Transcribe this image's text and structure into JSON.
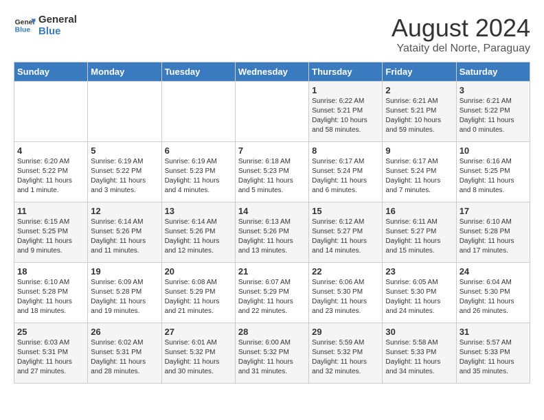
{
  "logo": {
    "general": "General",
    "blue": "Blue"
  },
  "title": {
    "month_year": "August 2024",
    "location": "Yataity del Norte, Paraguay"
  },
  "headers": [
    "Sunday",
    "Monday",
    "Tuesday",
    "Wednesday",
    "Thursday",
    "Friday",
    "Saturday"
  ],
  "weeks": [
    [
      {
        "day": "",
        "info": ""
      },
      {
        "day": "",
        "info": ""
      },
      {
        "day": "",
        "info": ""
      },
      {
        "day": "",
        "info": ""
      },
      {
        "day": "1",
        "info": "Sunrise: 6:22 AM\nSunset: 5:21 PM\nDaylight: 10 hours and 58 minutes."
      },
      {
        "day": "2",
        "info": "Sunrise: 6:21 AM\nSunset: 5:21 PM\nDaylight: 10 hours and 59 minutes."
      },
      {
        "day": "3",
        "info": "Sunrise: 6:21 AM\nSunset: 5:22 PM\nDaylight: 11 hours and 0 minutes."
      }
    ],
    [
      {
        "day": "4",
        "info": "Sunrise: 6:20 AM\nSunset: 5:22 PM\nDaylight: 11 hours and 1 minute."
      },
      {
        "day": "5",
        "info": "Sunrise: 6:19 AM\nSunset: 5:22 PM\nDaylight: 11 hours and 3 minutes."
      },
      {
        "day": "6",
        "info": "Sunrise: 6:19 AM\nSunset: 5:23 PM\nDaylight: 11 hours and 4 minutes."
      },
      {
        "day": "7",
        "info": "Sunrise: 6:18 AM\nSunset: 5:23 PM\nDaylight: 11 hours and 5 minutes."
      },
      {
        "day": "8",
        "info": "Sunrise: 6:17 AM\nSunset: 5:24 PM\nDaylight: 11 hours and 6 minutes."
      },
      {
        "day": "9",
        "info": "Sunrise: 6:17 AM\nSunset: 5:24 PM\nDaylight: 11 hours and 7 minutes."
      },
      {
        "day": "10",
        "info": "Sunrise: 6:16 AM\nSunset: 5:25 PM\nDaylight: 11 hours and 8 minutes."
      }
    ],
    [
      {
        "day": "11",
        "info": "Sunrise: 6:15 AM\nSunset: 5:25 PM\nDaylight: 11 hours and 9 minutes."
      },
      {
        "day": "12",
        "info": "Sunrise: 6:14 AM\nSunset: 5:26 PM\nDaylight: 11 hours and 11 minutes."
      },
      {
        "day": "13",
        "info": "Sunrise: 6:14 AM\nSunset: 5:26 PM\nDaylight: 11 hours and 12 minutes."
      },
      {
        "day": "14",
        "info": "Sunrise: 6:13 AM\nSunset: 5:26 PM\nDaylight: 11 hours and 13 minutes."
      },
      {
        "day": "15",
        "info": "Sunrise: 6:12 AM\nSunset: 5:27 PM\nDaylight: 11 hours and 14 minutes."
      },
      {
        "day": "16",
        "info": "Sunrise: 6:11 AM\nSunset: 5:27 PM\nDaylight: 11 hours and 15 minutes."
      },
      {
        "day": "17",
        "info": "Sunrise: 6:10 AM\nSunset: 5:28 PM\nDaylight: 11 hours and 17 minutes."
      }
    ],
    [
      {
        "day": "18",
        "info": "Sunrise: 6:10 AM\nSunset: 5:28 PM\nDaylight: 11 hours and 18 minutes."
      },
      {
        "day": "19",
        "info": "Sunrise: 6:09 AM\nSunset: 5:28 PM\nDaylight: 11 hours and 19 minutes."
      },
      {
        "day": "20",
        "info": "Sunrise: 6:08 AM\nSunset: 5:29 PM\nDaylight: 11 hours and 21 minutes."
      },
      {
        "day": "21",
        "info": "Sunrise: 6:07 AM\nSunset: 5:29 PM\nDaylight: 11 hours and 22 minutes."
      },
      {
        "day": "22",
        "info": "Sunrise: 6:06 AM\nSunset: 5:30 PM\nDaylight: 11 hours and 23 minutes."
      },
      {
        "day": "23",
        "info": "Sunrise: 6:05 AM\nSunset: 5:30 PM\nDaylight: 11 hours and 24 minutes."
      },
      {
        "day": "24",
        "info": "Sunrise: 6:04 AM\nSunset: 5:30 PM\nDaylight: 11 hours and 26 minutes."
      }
    ],
    [
      {
        "day": "25",
        "info": "Sunrise: 6:03 AM\nSunset: 5:31 PM\nDaylight: 11 hours and 27 minutes."
      },
      {
        "day": "26",
        "info": "Sunrise: 6:02 AM\nSunset: 5:31 PM\nDaylight: 11 hours and 28 minutes."
      },
      {
        "day": "27",
        "info": "Sunrise: 6:01 AM\nSunset: 5:32 PM\nDaylight: 11 hours and 30 minutes."
      },
      {
        "day": "28",
        "info": "Sunrise: 6:00 AM\nSunset: 5:32 PM\nDaylight: 11 hours and 31 minutes."
      },
      {
        "day": "29",
        "info": "Sunrise: 5:59 AM\nSunset: 5:32 PM\nDaylight: 11 hours and 32 minutes."
      },
      {
        "day": "30",
        "info": "Sunrise: 5:58 AM\nSunset: 5:33 PM\nDaylight: 11 hours and 34 minutes."
      },
      {
        "day": "31",
        "info": "Sunrise: 5:57 AM\nSunset: 5:33 PM\nDaylight: 11 hours and 35 minutes."
      }
    ]
  ]
}
